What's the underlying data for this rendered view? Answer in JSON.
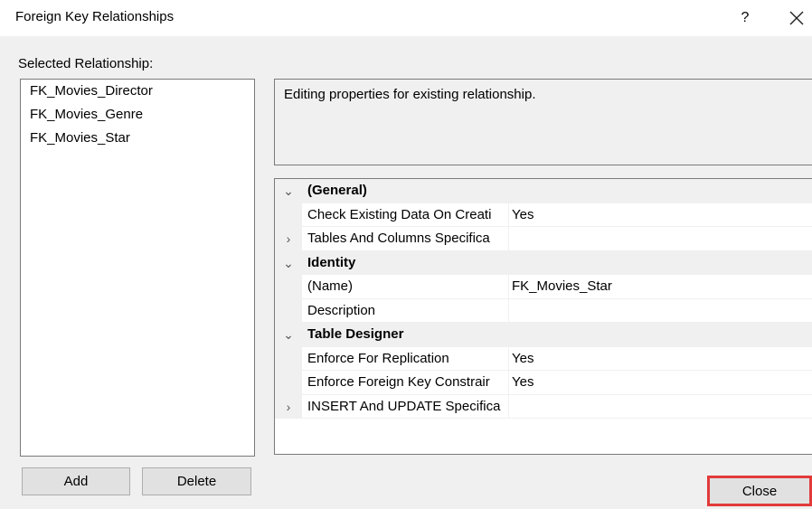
{
  "window": {
    "title": "Foreign Key Relationships",
    "help_label": "?"
  },
  "selected_label": "Selected Relationship:",
  "relationships": [
    "FK_Movies_Director",
    "FK_Movies_Genre",
    "FK_Movies_Star"
  ],
  "description": "Editing properties for existing relationship.",
  "properties": [
    {
      "type": "category",
      "name": "(General)",
      "expander": "⌄"
    },
    {
      "type": "property",
      "name": "Check Existing Data On Creati",
      "value": "Yes",
      "expander": ""
    },
    {
      "type": "property",
      "name": "Tables And Columns Specifica",
      "value": "",
      "expander": "›"
    },
    {
      "type": "category",
      "name": "Identity",
      "expander": "⌄"
    },
    {
      "type": "property",
      "name": "(Name)",
      "value": "FK_Movies_Star",
      "expander": ""
    },
    {
      "type": "property",
      "name": "Description",
      "value": "",
      "expander": ""
    },
    {
      "type": "category",
      "name": "Table Designer",
      "expander": "⌄"
    },
    {
      "type": "property",
      "name": "Enforce For Replication",
      "value": "Yes",
      "expander": ""
    },
    {
      "type": "property",
      "name": "Enforce Foreign Key Constrair",
      "value": "Yes",
      "expander": ""
    },
    {
      "type": "property",
      "name": "INSERT And UPDATE Specifica",
      "value": "",
      "expander": "›"
    }
  ],
  "buttons": {
    "add": "Add",
    "delete": "Delete",
    "close": "Close"
  },
  "colors": {
    "highlight": "#e23a3a",
    "dialog_bg": "#f0f0f0"
  }
}
